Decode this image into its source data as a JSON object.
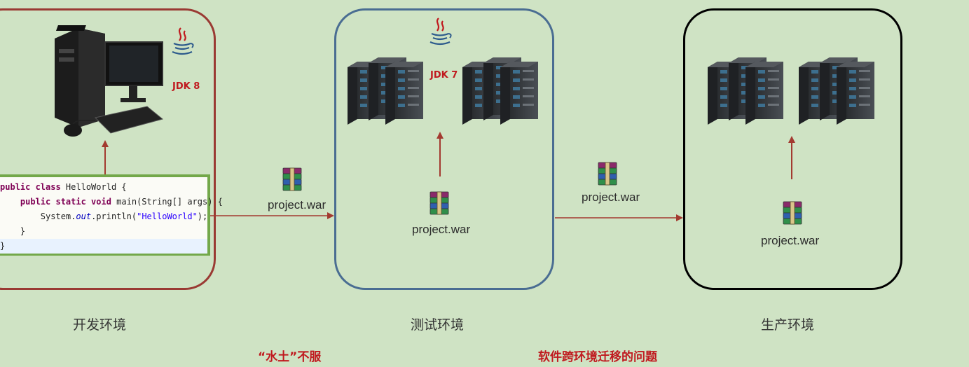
{
  "environments": {
    "dev": {
      "label": "开发环境",
      "jdk": "JDK 8"
    },
    "test": {
      "label": "测试环境",
      "jdk": "JDK 7",
      "war": "project.war"
    },
    "prod": {
      "label": "生产环境",
      "war": "project.war"
    }
  },
  "transfers": {
    "dev_to_test": "project.war",
    "test_to_prod": "project.war"
  },
  "code": {
    "line1_a": "public class ",
    "line1_b": "HelloWorld {",
    "line2_a": "    public static void ",
    "line2_b": "main(String[] args) {",
    "line3_a": "        System.",
    "line3_b": "out",
    "line3_c": ".println(",
    "line3_d": "\"HelloWorld\"",
    "line3_e": ");",
    "line4": "    }",
    "line5": "}"
  },
  "captions": {
    "left": "“水土”不服",
    "right": "软件跨环境迁移的问题"
  },
  "colors": {
    "dev_border": "#9a3a33",
    "test_border": "#4a6d92",
    "prod_border": "#000000",
    "arrow": "#a33a30",
    "caption": "#c0191e",
    "background": "#cfe3c4"
  }
}
